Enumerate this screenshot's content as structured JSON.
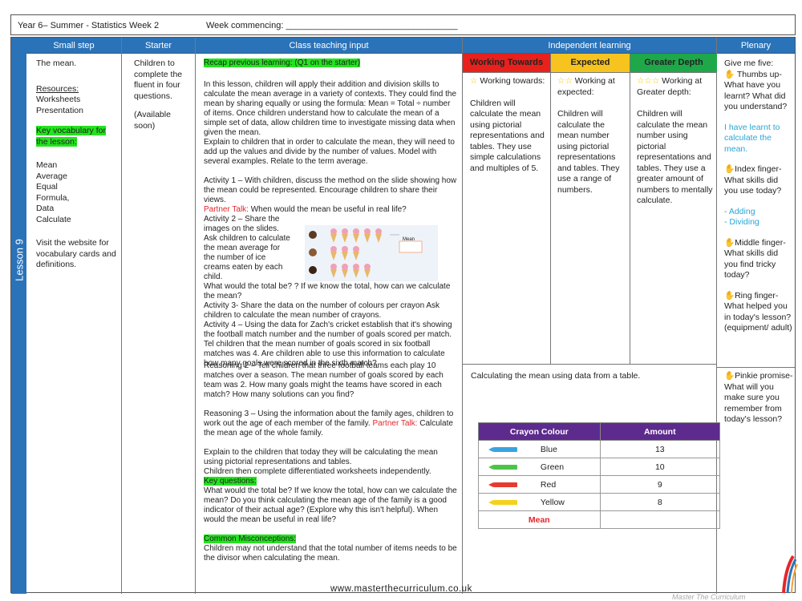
{
  "header": {
    "title": "Year 6– Summer - Statistics Week 2",
    "week": "Week commencing: ___________________________________"
  },
  "lesson_label": "Lesson 9",
  "columns": {
    "small_step": "Small step",
    "starter": "Starter",
    "class_teaching": "Class teaching input",
    "independent": "Independent learning",
    "plenary": "Plenary"
  },
  "small_step": {
    "title": "The mean.",
    "resources_label": "Resources:",
    "resources": [
      "Worksheets",
      "Presentation"
    ],
    "vocab_label": "Key vocabulary for the lesson:",
    "vocab": [
      "Mean",
      "Average",
      "Equal",
      "Formula,",
      "Data",
      "Calculate"
    ],
    "visit": "Visit the website for vocabulary cards and definitions."
  },
  "starter": {
    "text": "Children to complete the fluent in four questions.",
    "available": "(Available soon)"
  },
  "teaching": {
    "recap": "Recap previous learning: (Q1 on the starter)",
    "p1": "In this lesson, children will apply their addition and division skills to calculate the mean average in a variety of contexts. They could find the mean by sharing equally or using the formula: Mean = Total ÷ number of items. Once children understand how to calculate the mean of a simple set of data, allow children time to investigate missing data when given the mean.",
    "p2": "Explain to children that in order to calculate the mean, they will need to add up the values and divide by the number of values. Model with several examples.  Relate to the term average.",
    "a1": "Activity 1 – With children, discuss the method on the slide showing how the mean could be represented. Encourage children to share their views.",
    "pt1_label": "Partner Talk:",
    "pt1": " When would the mean be useful in real life?",
    "a2": "Activity 2 – Share the images on the slides. Ask children to calculate the mean average for the number of ice creams eaten by each child.",
    "mean_box": "Mean",
    "a2b": "What would the total be? ? If we know the total, how can we calculate the mean?",
    "a3": "Activity 3- Share the data on the number of colours per crayon Ask children to calculate the mean number of crayons.",
    "a4": " Activity 4 – Using the data for Zach's cricket establish that it's showing the football match number and the number of goals scored per match. Tel children that the  mean number of goals scored in six football matches was 4. Are children able to use this information to calculate how many goals were scored in the sixth match?",
    "r2": "Reasoning 2 – Tell children that three football teams each play 10 matches over a season. The mean number of goals scored by each team was 2. How many goals might the teams have scored in each match? How many solutions can you find?",
    "r3a": "Reasoning 3 – Using the information about the family ages, children to work out the age of each member of the family.",
    "pt2_label": "Partner Talk:",
    "r3b": " Calculate the mean age of the whole family.",
    "e1": "Explain to the children that today they will be calculating the mean using pictorial representations and tables.",
    "e2": "Children then complete differentiated worksheets independently.",
    "kq_label": "Key questions:",
    "kq": "What would the total be? If we know the total, how can we calculate the mean? Do you think calculating the mean age of the family is a good indicator of their actual age? (Explore why this isn't helpful). When would the mean be useful in real life?",
    "cm_label": "Common Misconceptions:",
    "cm": "Children may not understand that the total number of items needs to be the divisor when calculating the mean."
  },
  "independent": {
    "wt_label": "Working Towards",
    "ex_label": "Expected",
    "gd_label": "Greater Depth",
    "colors": {
      "wt": "#e8211c",
      "ex": "#f7c31f",
      "gd": "#1ea84a"
    },
    "wt_title": "Working towards:",
    "ex_title": "Working at expected:",
    "gd_title": "Working at Greater depth:",
    "wt_body": "Children will calculate the mean using pictorial representations and tables. They use simple calculations and multiples of 5.",
    "ex_body": "Children will calculate the mean number using pictorial representations and tables. They use a range of numbers.",
    "gd_body": "Children will calculate the mean number using pictorial representations and tables. They use a greater amount of numbers to mentally calculate.",
    "caption": "Calculating the mean using data from a table.",
    "table": {
      "headers": [
        "Crayon Colour",
        "Amount"
      ],
      "rows": [
        {
          "colour": "Blue",
          "amount": "13",
          "hex": "#3aa3e0"
        },
        {
          "colour": "Green",
          "amount": "10",
          "hex": "#4cc44a"
        },
        {
          "colour": "Red",
          "amount": "9",
          "hex": "#e53b30"
        },
        {
          "colour": "Yellow",
          "amount": "8",
          "hex": "#f4d21c"
        }
      ],
      "mean_label": "Mean"
    }
  },
  "plenary": {
    "p1": "Give me five:",
    "thumbs": "Thumbs up- What have you learnt? What did you understand?",
    "learnt": "I have learnt to calculate the mean.",
    "index": "Index finger- What skills did you use today?",
    "adding": "- Adding",
    "dividing": "- Dividing",
    "middle": "Middle finger- What skills did you find tricky today?",
    "ring": "Ring finger- What helped you in today's lesson? (equipment/ adult)",
    "pinkie": "Pinkie promise- What will you make sure you remember from today's lesson?"
  },
  "footer": {
    "url": "www.masterthecurriculum.co.uk",
    "brand": "Master The Curriculum"
  }
}
